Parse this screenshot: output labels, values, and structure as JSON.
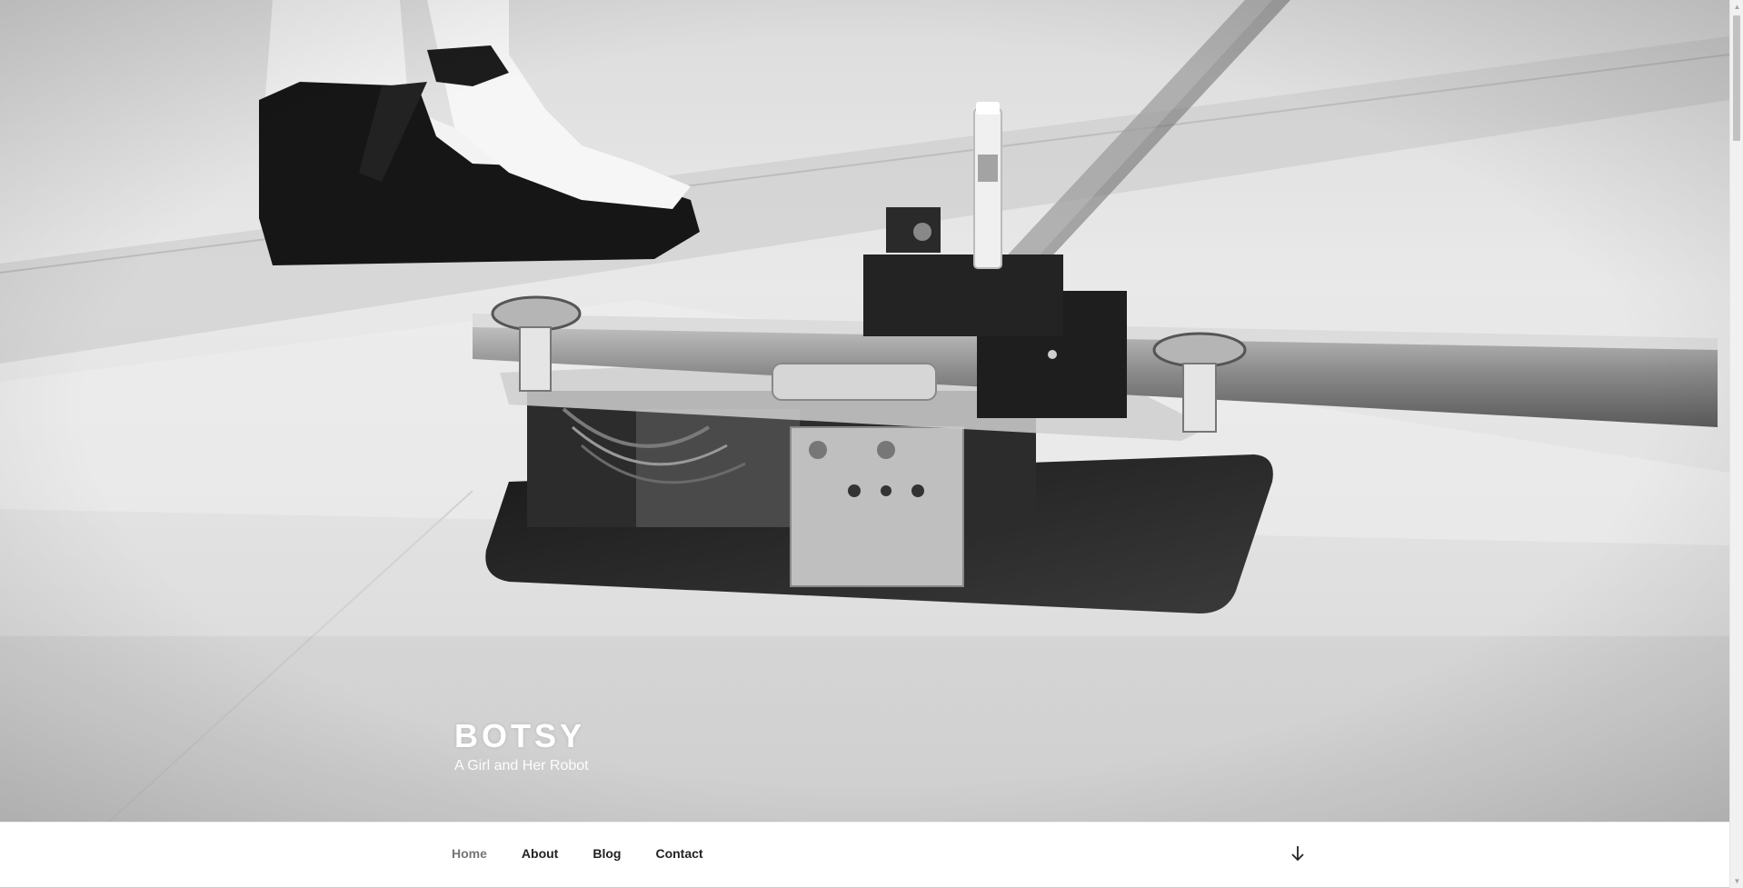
{
  "site": {
    "title": "BOTSY",
    "description": "A Girl and Her Robot"
  },
  "nav": {
    "items": [
      {
        "label": "Home",
        "current": true
      },
      {
        "label": "About",
        "current": false
      },
      {
        "label": "Blog",
        "current": false
      },
      {
        "label": "Contact",
        "current": false
      }
    ],
    "scroll_icon": "arrow-down-icon"
  },
  "hero": {
    "image": "black-and-white photo of a drawing robot on a floor rail beside a person's feet in black flat shoes"
  },
  "colors": {
    "title_text": "#ffffff",
    "nav_text": "#222222",
    "nav_current": "#767676",
    "background": "#ffffff"
  }
}
